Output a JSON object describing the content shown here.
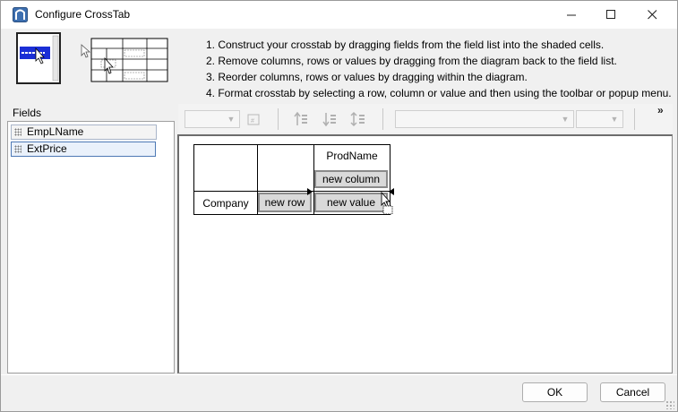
{
  "window": {
    "title": "Configure CrossTab",
    "controls": {
      "minimize_icon": "minimize-icon",
      "maximize_icon": "maximize-icon",
      "close_icon": "close-icon"
    }
  },
  "instructions": [
    "1. Construct your crosstab by dragging fields from the field list into the shaded cells.",
    "2. Remove columns, rows or values by dragging from the diagram back to the field list.",
    "3. Reorder columns, rows or values by dragging within the diagram.",
    "4. Format crosstab by selecting a row, column or value and then using the toolbar or popup menu."
  ],
  "fields": {
    "label": "Fields",
    "items": [
      "EmpLName",
      "ExtPrice"
    ],
    "selected_index": 1
  },
  "toolbar": {
    "more_label": "»",
    "icons": [
      "format-icon",
      "sort-ascending-icon",
      "sort-descending-icon",
      "sort-custom-icon"
    ]
  },
  "crosstab": {
    "column_field": "ProdName",
    "column_placeholder": "new column",
    "row_field": "Company",
    "row_placeholder": "new row",
    "value_placeholder": "new value"
  },
  "buttons": {
    "ok": "OK",
    "cancel": "Cancel"
  }
}
